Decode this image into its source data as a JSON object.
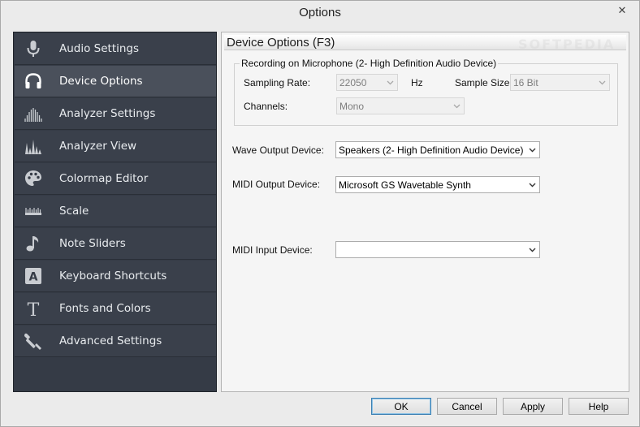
{
  "window": {
    "title": "Options",
    "close_icon": "close-icon"
  },
  "sidebar": {
    "items": [
      {
        "label": "Audio Settings",
        "icon": "microphone-icon"
      },
      {
        "label": "Device Options",
        "icon": "headphones-icon",
        "active": true
      },
      {
        "label": "Analyzer Settings",
        "icon": "waveform-icon"
      },
      {
        "label": "Analyzer View",
        "icon": "spectrum-icon"
      },
      {
        "label": "Colormap Editor",
        "icon": "palette-icon"
      },
      {
        "label": "Scale",
        "icon": "ruler-icon"
      },
      {
        "label": "Note Sliders",
        "icon": "music-note-icon"
      },
      {
        "label": "Keyboard Shortcuts",
        "icon": "keyboard-key-icon"
      },
      {
        "label": "Fonts and Colors",
        "icon": "font-icon"
      },
      {
        "label": "Advanced Settings",
        "icon": "wrench-icon"
      }
    ]
  },
  "panel": {
    "title": "Device Options (F3)",
    "watermark": "SOFTPEDIA",
    "recording_group": {
      "legend": "Recording on Microphone (2- High Definition Audio Device)",
      "sampling_rate_label": "Sampling Rate:",
      "sampling_rate_value": "22050",
      "hz_label": "Hz",
      "sample_size_label": "Sample Size:",
      "sample_size_value": "16 Bit",
      "channels_label": "Channels:",
      "channels_value": "Mono"
    },
    "wave_output_label": "Wave Output Device:",
    "wave_output_value": "Speakers (2- High Definition Audio Device)",
    "midi_output_label": "MIDI Output Device:",
    "midi_output_value": "Microsoft GS Wavetable Synth",
    "midi_input_label": "MIDI Input Device:",
    "midi_input_value": ""
  },
  "footer": {
    "ok": "OK",
    "cancel": "Cancel",
    "apply": "Apply",
    "help": "Help"
  },
  "colors": {
    "sidebar_bg": "#353b46",
    "sidebar_active": "#4a505b",
    "sidebar_text": "#e9ecef",
    "icon_color": "#c9ccd1"
  }
}
